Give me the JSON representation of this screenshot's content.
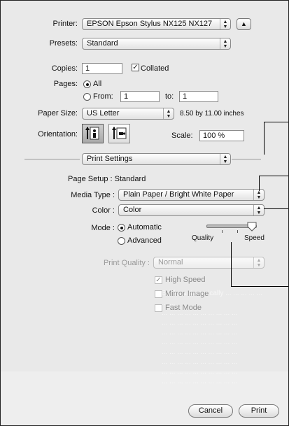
{
  "printer": {
    "label": "Printer:",
    "value": "EPSON Epson Stylus NX125 NX127"
  },
  "presets": {
    "label": "Presets:",
    "value": "Standard"
  },
  "copies": {
    "label": "Copies:",
    "value": "1",
    "collated_label": "Collated",
    "collated_checked": true
  },
  "pages": {
    "label": "Pages:",
    "all_label": "All",
    "from_label": "From:",
    "from_value": "1",
    "to_label": "to:",
    "to_value": "1"
  },
  "paper_size": {
    "label": "Paper Size:",
    "value": "US Letter",
    "dimensions": "8.50 by 11.00 inches"
  },
  "orientation": {
    "label": "Orientation:"
  },
  "scale": {
    "label": "Scale:",
    "value": "100 %"
  },
  "section_popup": {
    "value": "Print Settings"
  },
  "page_setup": {
    "text": "Page Setup : Standard"
  },
  "media_type": {
    "label": "Media Type :",
    "value": "Plain Paper / Bright White Paper"
  },
  "color": {
    "label": "Color :",
    "value": "Color"
  },
  "mode": {
    "label": "Mode :",
    "automatic_label": "Automatic",
    "advanced_label": "Advanced",
    "quality_label": "Quality",
    "speed_label": "Speed",
    "slider_value": 1.0
  },
  "print_quality": {
    "label": "Print Quality :",
    "value": "Normal"
  },
  "options": [
    {
      "label": "High Speed",
      "checked": true
    },
    {
      "label": "Mirror Image",
      "checked": false
    },
    {
      "label": "Fast Mode",
      "checked": false
    }
  ],
  "buttons": {
    "cancel": "Cancel",
    "print": "Print"
  }
}
